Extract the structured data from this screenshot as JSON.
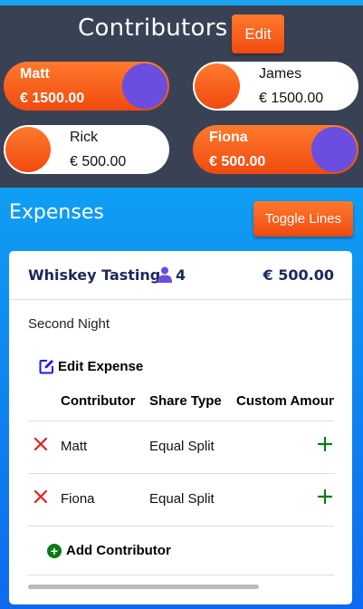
{
  "colors": {
    "header_bg": "#394255",
    "accent_orange_top": "#ff7a2c",
    "accent_orange_bottom": "#f04a0f",
    "toggle_knob": "#6a4ee0",
    "expenses_gradient_top": "#0f9ef3",
    "expenses_gradient_bottom": "#0d6af0",
    "expense_title_color": "#1a2a5a",
    "remove_icon_color": "#e02020",
    "add_icon_color": "#0a7a14"
  },
  "contributors": {
    "title": "Contributors",
    "edit_label": "Edit",
    "pills": [
      {
        "name": "Matt",
        "amount": "€ 1500.00",
        "active": true
      },
      {
        "name": "James",
        "amount": "€ 1500.00",
        "active": false
      },
      {
        "name": "Rick",
        "amount": "€ 500.00",
        "active": false
      },
      {
        "name": "Fiona",
        "amount": "€ 500.00",
        "active": true
      }
    ]
  },
  "expenses": {
    "title": "Expenses",
    "toggle_label": "Toggle Lines",
    "items": [
      {
        "name": "Whiskey Tasting",
        "participant_icon": "person-icon",
        "participant_count": "4",
        "total": "€ 500.00",
        "description": "Second Night",
        "edit_label": "Edit Expense",
        "columns": [
          "Contributor",
          "Share Type",
          "Custom Amount"
        ],
        "rows": [
          {
            "contributor": "Matt",
            "share_type": "Equal Split"
          },
          {
            "contributor": "Fiona",
            "share_type": "Equal Split"
          }
        ],
        "add_label": "Add Contributor"
      }
    ]
  }
}
